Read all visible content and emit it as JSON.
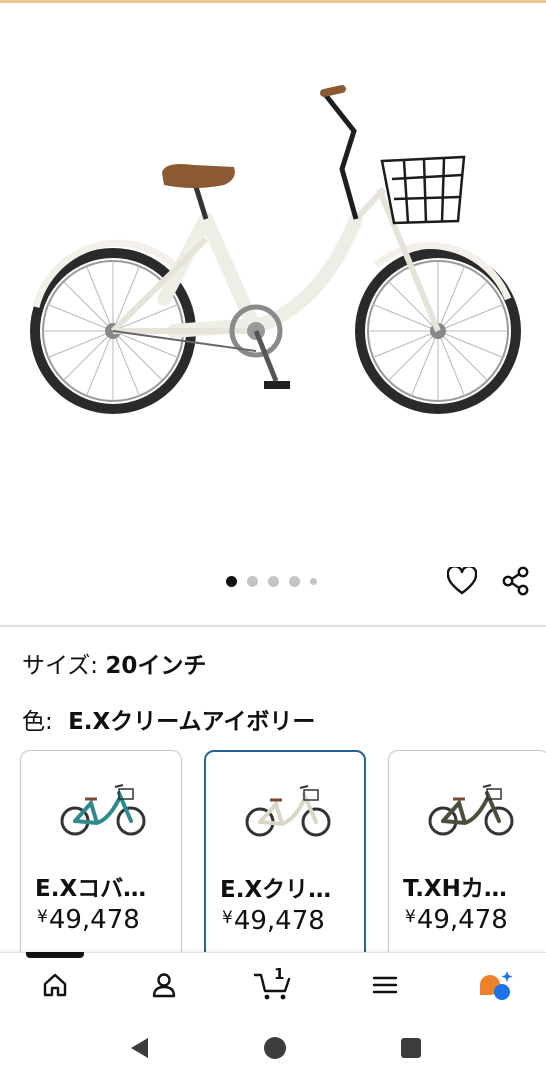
{
  "product": {
    "image_alt": "bicycle-cream-ivory",
    "carousel_dots": 5,
    "carousel_active": 0
  },
  "actions": {
    "wishlist_icon": "heart-icon",
    "share_icon": "share-icon"
  },
  "variation": {
    "size_label": "サイズ: ",
    "size_value": "20インチ",
    "color_label": "色: ",
    "color_value": "E.Xクリームアイボリー"
  },
  "swatches": [
    {
      "name": "E.Xコバ…",
      "yen": "¥",
      "price": "49,478",
      "frame_color": "#2f8a8e",
      "selected": false
    },
    {
      "name": "E.Xクリ…",
      "yen": "¥",
      "price": "49,478",
      "frame_color": "#f1efe6",
      "selected": true
    },
    {
      "name": "T.XHカ…",
      "yen": "¥",
      "price": "49,478",
      "frame_color": "#4c4f3c",
      "selected": false
    }
  ],
  "bottom_nav": {
    "items": [
      "home-icon",
      "account-icon",
      "cart-icon",
      "menu-icon",
      "assistant-icon"
    ],
    "cart_count": "1"
  },
  "system_nav": [
    "back-icon",
    "home-circle-icon",
    "recents-icon"
  ],
  "colors": {
    "selected_border": "#27619a",
    "assistant_orange": "#f0812b",
    "assistant_blue": "#1a73e8"
  }
}
